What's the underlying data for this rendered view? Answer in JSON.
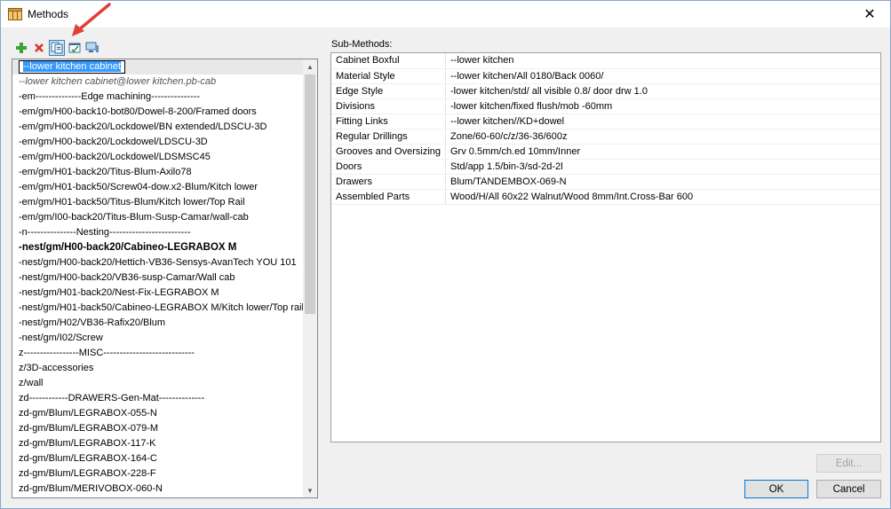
{
  "window": {
    "title": "Methods",
    "close_glyph": "✕"
  },
  "toolbar": {
    "icons": [
      "add-icon",
      "delete-icon",
      "copy-icon",
      "edit-details-icon",
      "monitor-icon"
    ]
  },
  "sub_methods_label": "Sub-Methods:",
  "list": {
    "editing_value": "--lower kitchen cabinet",
    "items": [
      {
        "text": "--lower kitchen cabinet@lower kitchen.pb-cab",
        "style": "italic"
      },
      {
        "text": "-em--------------Edge machining---------------",
        "style": ""
      },
      {
        "text": "-em/gm/H00-back10-bot80/Dowel-8-200/Framed doors",
        "style": ""
      },
      {
        "text": "-em/gm/H00-back20/Lockdowel/BN extended/LDSCU-3D",
        "style": ""
      },
      {
        "text": "-em/gm/H00-back20/Lockdowel/LDSCU-3D",
        "style": ""
      },
      {
        "text": "-em/gm/H00-back20/Lockdowel/LDSMSC45",
        "style": ""
      },
      {
        "text": "-em/gm/H01-back20/Titus-Blum-Axilo78",
        "style": ""
      },
      {
        "text": "-em/gm/H01-back50/Screw04-dow.x2-Blum/Kitch lower",
        "style": ""
      },
      {
        "text": "-em/gm/H01-back50/Titus-Blum/Kitch lower/Top Rail",
        "style": ""
      },
      {
        "text": "-em/gm/I00-back20/Titus-Blum-Susp-Camar/wall-cab",
        "style": ""
      },
      {
        "text": "-n---------------Nesting-------------------------",
        "style": ""
      },
      {
        "text": "-nest/gm/H00-back20/Cabineo-LEGRABOX M",
        "style": "bold"
      },
      {
        "text": "-nest/gm/H00-back20/Hettich-VB36-Sensys-AvanTech YOU 101",
        "style": ""
      },
      {
        "text": "-nest/gm/H00-back20/VB36-susp-Camar/Wall cab",
        "style": ""
      },
      {
        "text": "-nest/gm/H01-back20/Nest-Fix-LEGRABOX M",
        "style": ""
      },
      {
        "text": "-nest/gm/H01-back50/Cabineo-LEGRABOX M/Kitch lower/Top rail",
        "style": ""
      },
      {
        "text": "-nest/gm/H02/VB36-Rafix20/Blum",
        "style": ""
      },
      {
        "text": "-nest/gm/I02/Screw",
        "style": ""
      },
      {
        "text": "z-----------------MISC----------------------------",
        "style": ""
      },
      {
        "text": "z/3D-accessories",
        "style": ""
      },
      {
        "text": "z/wall",
        "style": ""
      },
      {
        "text": "zd------------DRAWERS-Gen-Mat--------------",
        "style": ""
      },
      {
        "text": "zd-gm/Blum/LEGRABOX-055-N",
        "style": ""
      },
      {
        "text": "zd-gm/Blum/LEGRABOX-079-M",
        "style": ""
      },
      {
        "text": "zd-gm/Blum/LEGRABOX-117-K",
        "style": ""
      },
      {
        "text": "zd-gm/Blum/LEGRABOX-164-C",
        "style": ""
      },
      {
        "text": "zd-gm/Blum/LEGRABOX-228-F",
        "style": ""
      },
      {
        "text": "zd-gm/Blum/MERIVOBOX-060-N",
        "style": ""
      }
    ]
  },
  "sub_methods": [
    {
      "key": "Cabinet Boxful",
      "value": "--lower kitchen"
    },
    {
      "key": "Material Style",
      "value": "--lower kitchen/All 0180/Back 0060/"
    },
    {
      "key": "Edge Style",
      "value": "-lower kitchen/std/ all visible 0.8/ door drw 1.0"
    },
    {
      "key": "Divisions",
      "value": "-lower kitchen/fixed flush/mob -60mm"
    },
    {
      "key": "Fitting Links",
      "value": "--lower kitchen//KD+dowel"
    },
    {
      "key": "Regular Drillings",
      "value": "Zone/60-60/c/z/36-36/600z"
    },
    {
      "key": "Grooves and Oversizing",
      "value": "Grv 0.5mm/ch.ed 10mm/Inner"
    },
    {
      "key": "Doors",
      "value": "Std/app 1.5/bin-3/sd-2d-2l"
    },
    {
      "key": "Drawers",
      "value": "Blum/TANDEMBOX-069-N"
    },
    {
      "key": "Assembled Parts",
      "value": "Wood/H/All 60x22 Walnut/Wood 8mm/Int.Cross-Bar 600"
    }
  ],
  "buttons": {
    "edit": "Edit...",
    "ok": "OK",
    "cancel": "Cancel"
  },
  "colors": {
    "accent": "#0078d7",
    "arrow": "#e0403a",
    "selection": "#3399ff"
  }
}
